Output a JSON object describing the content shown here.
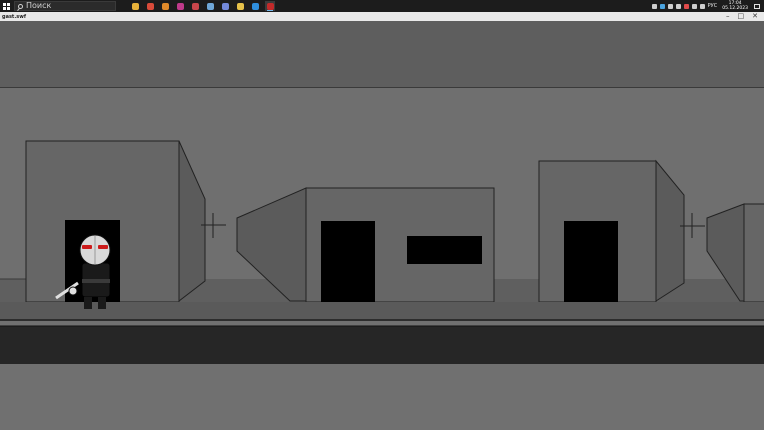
{
  "taskbar": {
    "search_placeholder": "Поиск",
    "apps": [
      {
        "name": "file-explorer-icon",
        "color": "#e8b23a"
      },
      {
        "name": "chrome-icon",
        "color": "#d94b3a"
      },
      {
        "name": "browser-icon",
        "color": "#e08a2a"
      },
      {
        "name": "app-icon",
        "color": "#c03a8a"
      },
      {
        "name": "chrome-profile-icon",
        "color": "#c9464b"
      },
      {
        "name": "steam-icon",
        "color": "#6fa7d8"
      },
      {
        "name": "discord-icon",
        "color": "#7389da"
      },
      {
        "name": "folder-icon",
        "color": "#e6c14a"
      },
      {
        "name": "vscode-icon",
        "color": "#2f8fdd"
      },
      {
        "name": "game-icon",
        "color": "#c22a2a"
      }
    ],
    "tray_lang": "РУС",
    "time": "17:04",
    "date": "05.12.2023"
  },
  "window": {
    "title": "gast.swf"
  },
  "game": {
    "colors": {
      "sky": "#5a5a5a",
      "wall": "#707070",
      "building": "#636363",
      "dark_band": "#262626",
      "door": "#000000"
    },
    "character": {
      "name": "hank",
      "goggle_color": "#cc1a1a"
    }
  }
}
